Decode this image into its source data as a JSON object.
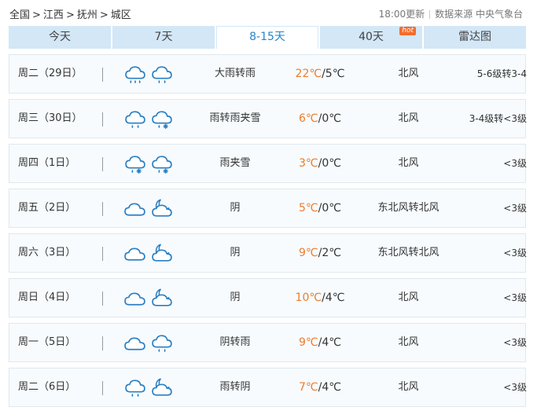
{
  "breadcrumb": {
    "items": [
      "全国",
      "江西",
      "抚州",
      "城区"
    ],
    "separator": ">"
  },
  "source": {
    "updated": "18:00更新",
    "label": "数据来源 中央气象台"
  },
  "tabs": [
    {
      "label": "今天",
      "active": false
    },
    {
      "label": "7天",
      "active": false
    },
    {
      "label": "8-15天",
      "active": true
    },
    {
      "label": "40天",
      "active": false,
      "badge": "hot"
    },
    {
      "label": "雷达图",
      "active": false
    }
  ],
  "colors": {
    "accent": "#2a84c8",
    "tab_bg": "#d3e7f7",
    "high_temp": "#f07b2c",
    "hot_badge": "#f36d2d",
    "row_bg": "#f7fbfe",
    "icon_stroke": "#2b7fc2"
  },
  "forecast": [
    {
      "day": "周二（29日）",
      "icons": [
        "heavy-rain-icon",
        "rain-icon"
      ],
      "desc": "大雨转雨",
      "high": "22℃",
      "low": "/5℃",
      "wind": "北风",
      "level": "5-6级转3-4"
    },
    {
      "day": "周三（30日）",
      "icons": [
        "rain-icon",
        "sleet-icon"
      ],
      "desc": "雨转雨夹雪",
      "high": "6℃",
      "low": "/0℃",
      "wind": "北风",
      "level": "3-4级转<3级"
    },
    {
      "day": "周四（1日）",
      "icons": [
        "sleet-icon",
        "sleet-icon"
      ],
      "desc": "雨夹雪",
      "high": "3℃",
      "low": "/0℃",
      "wind": "北风",
      "level": "<3级"
    },
    {
      "day": "周五（2日）",
      "icons": [
        "cloud-icon",
        "night-cloud-icon"
      ],
      "desc": "阴",
      "high": "5℃",
      "low": "/0℃",
      "wind": "东北风转北风",
      "level": "<3级"
    },
    {
      "day": "周六（3日）",
      "icons": [
        "cloud-icon",
        "night-cloud-icon"
      ],
      "desc": "阴",
      "high": "9℃",
      "low": "/2℃",
      "wind": "东北风转北风",
      "level": "<3级"
    },
    {
      "day": "周日（4日）",
      "icons": [
        "cloud-icon",
        "night-cloud-icon"
      ],
      "desc": "阴",
      "high": "10℃",
      "low": "/4℃",
      "wind": "北风",
      "level": "<3级"
    },
    {
      "day": "周一（5日）",
      "icons": [
        "cloud-icon",
        "rain-icon"
      ],
      "desc": "阴转雨",
      "high": "9℃",
      "low": "/4℃",
      "wind": "北风",
      "level": "<3级"
    },
    {
      "day": "周二（6日）",
      "icons": [
        "rain-icon",
        "night-cloud-icon"
      ],
      "desc": "雨转阴",
      "high": "7℃",
      "low": "/4℃",
      "wind": "北风",
      "level": "<3级"
    }
  ]
}
